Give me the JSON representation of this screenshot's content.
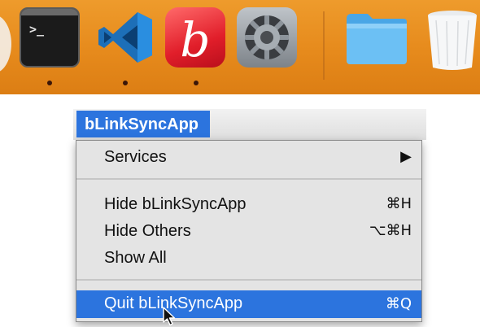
{
  "dock": {
    "items": [
      {
        "name": "Terminal",
        "icon": "terminal-icon",
        "prompt": ">_",
        "running": true
      },
      {
        "name": "Visual Studio Code",
        "icon": "vscode-icon",
        "running": true
      },
      {
        "name": "BBEdit",
        "icon": "bbedit-icon",
        "letter": "b",
        "running": true
      },
      {
        "name": "System Preferences",
        "icon": "gear-icon",
        "running": false
      },
      {
        "name": "Folder",
        "icon": "folder-icon",
        "running": false
      },
      {
        "name": "Trash",
        "icon": "trash-icon",
        "running": false
      }
    ],
    "background_color": "#e68a1c"
  },
  "menu": {
    "app_title": "bLinkSyncApp",
    "highlight_color": "#2c74de",
    "items": [
      {
        "label": "Services",
        "shortcut": "▶"
      },
      {
        "label": "Hide bLinkSyncApp",
        "shortcut": "⌘H"
      },
      {
        "label": "Hide Others",
        "shortcut": "⌥⌘H"
      },
      {
        "label": "Show All",
        "shortcut": ""
      },
      {
        "label": "Quit bLinkSyncApp",
        "shortcut": "⌘Q"
      }
    ]
  }
}
